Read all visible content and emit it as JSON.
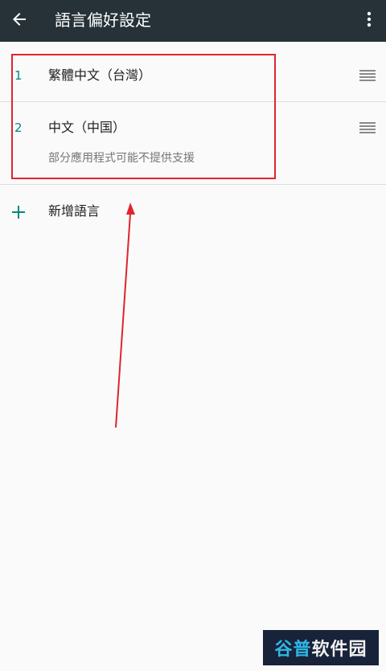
{
  "header": {
    "title": "語言偏好設定",
    "background": "#263238"
  },
  "languages": [
    {
      "number": "1",
      "name": "繁體中文（台灣）",
      "note": ""
    },
    {
      "number": "2",
      "name": "中文（中国）",
      "note": "部分應用程式可能不提供支援"
    }
  ],
  "add_language": {
    "label": "新增語言",
    "icon": "plus-icon"
  },
  "watermark": {
    "part1": "谷普",
    "part2": "软件园"
  },
  "colors": {
    "accent": "#00897b",
    "annotation": "#e0242e"
  }
}
